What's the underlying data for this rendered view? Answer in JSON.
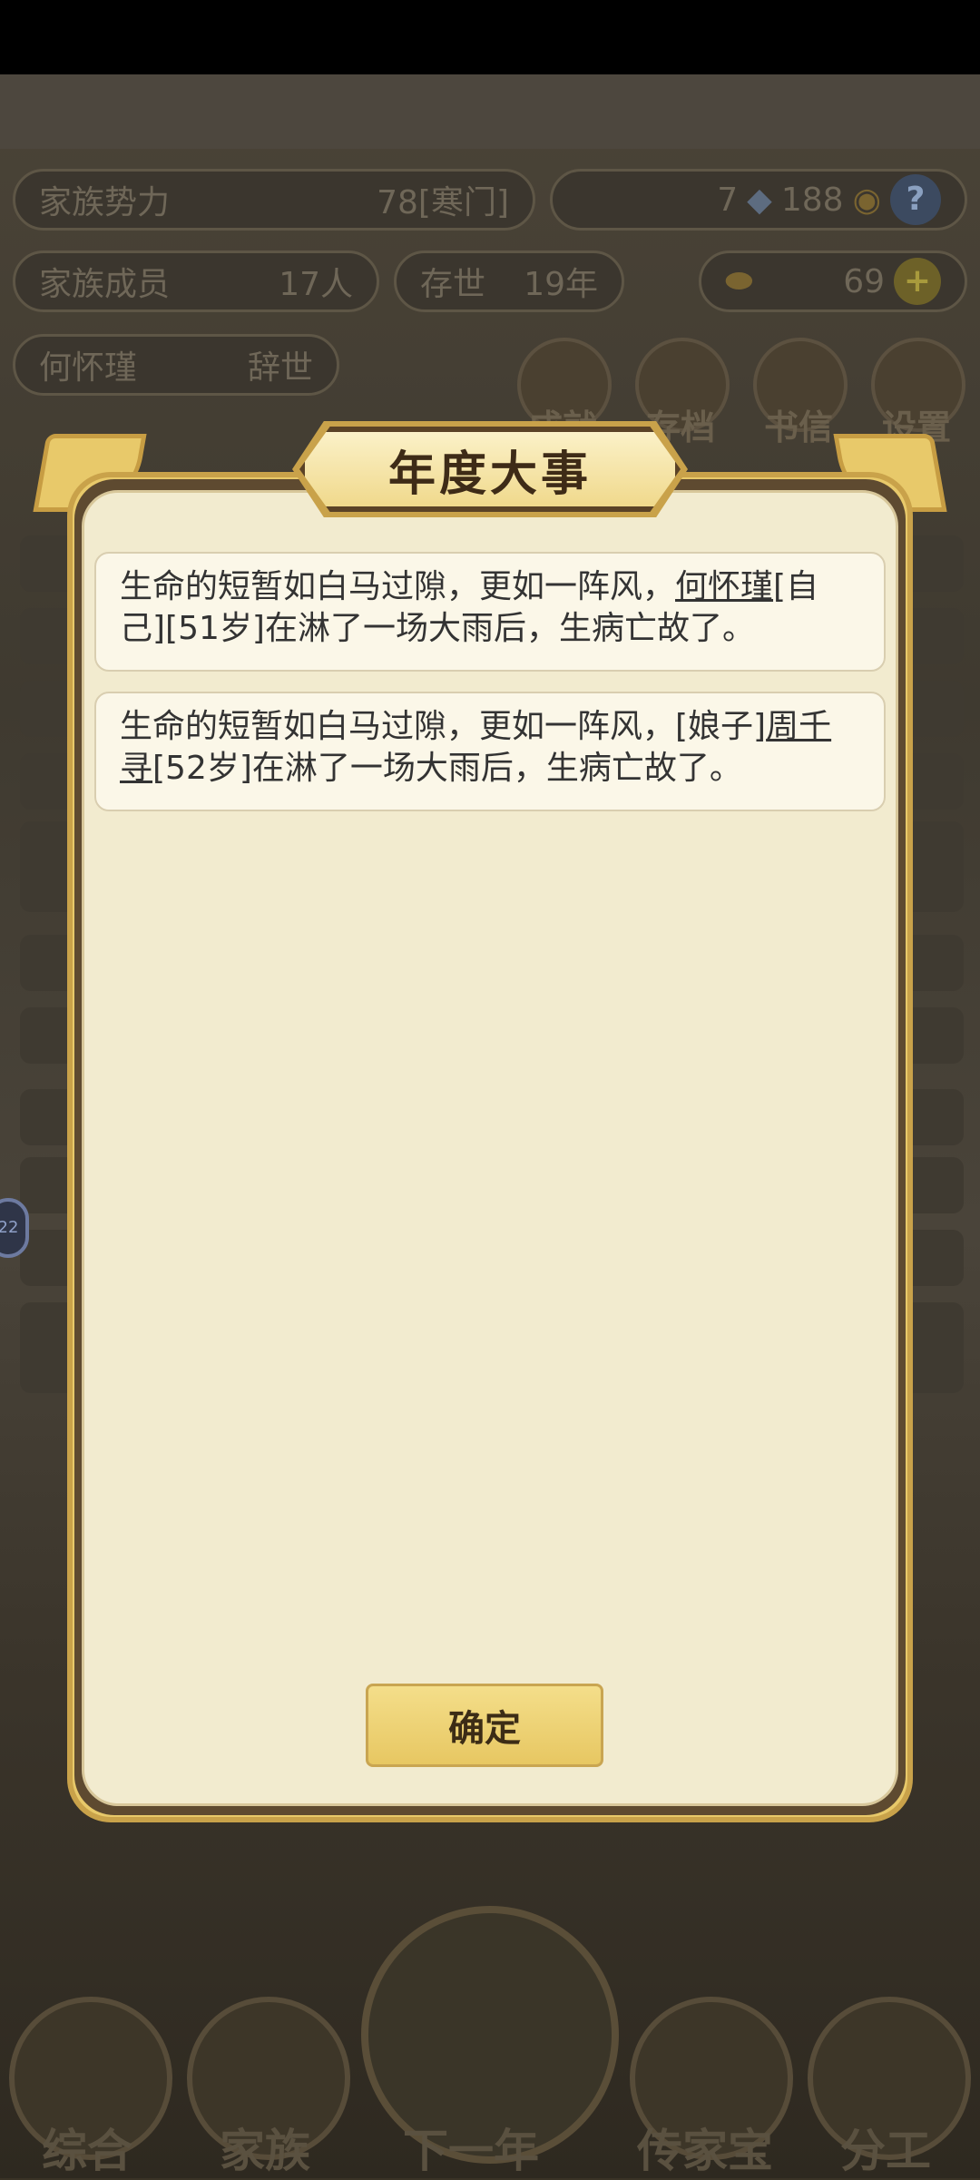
{
  "header": {
    "family_power_label": "家族势力",
    "family_power_value": "78[寒门]",
    "gems": "7",
    "coins": "188",
    "help_icon": "question-icon",
    "members_label": "家族成员",
    "members_value": "17人",
    "existence_label": "存世",
    "existence_value": "19年",
    "gold_value": "69",
    "person_name": "何怀瑾",
    "person_status": "辞世"
  },
  "round_buttons": [
    {
      "label": "成就"
    },
    {
      "label": "存档"
    },
    {
      "label": "书信"
    },
    {
      "label": "设置"
    }
  ],
  "bottom_nav": [
    {
      "label": "综合"
    },
    {
      "label": "家族"
    },
    {
      "label": "下一年"
    },
    {
      "label": "传家宝"
    },
    {
      "label": "分工"
    }
  ],
  "side_badge": "22",
  "dialog": {
    "title": "年度大事",
    "events": [
      {
        "pre": "生命的短暂如白马过隙，更如一阵风，",
        "name": "何怀瑾",
        "post": "[自己][51岁]在淋了一场大雨后，生病亡故了。"
      },
      {
        "pre": "生命的短暂如白马过隙，更如一阵风，[娘子]",
        "name": "周千寻",
        "post": "[52岁]在淋了一场大雨后，生病亡故了。"
      }
    ],
    "confirm_label": "确定"
  },
  "colors": {
    "dialog_bg": "#f2ebcf",
    "frame_gold": "#e8c96a",
    "button_gold": "#e7c762"
  }
}
